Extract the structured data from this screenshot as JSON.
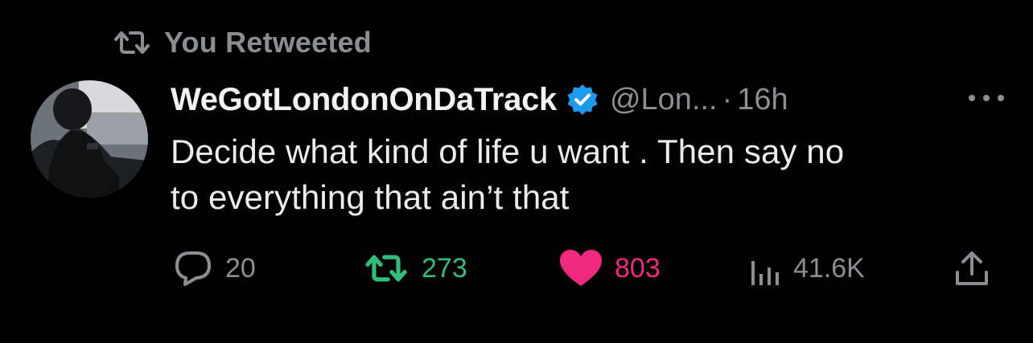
{
  "retweet_header": {
    "label": "You Retweeted",
    "icon": "retweet-icon"
  },
  "tweet": {
    "avatar_icon": "avatar",
    "display_name": "WeGotLondonOnDaTrack",
    "verified": true,
    "handle": "@Lon...",
    "separator": "·",
    "timestamp": "16h",
    "text_line1": "Decide what kind of life u want . Then say no",
    "text_line2": "to everything that ain’t that"
  },
  "actions": {
    "reply": {
      "count": "20",
      "icon": "reply-icon"
    },
    "retweet": {
      "count": "273",
      "icon": "retweet-icon",
      "active": true
    },
    "like": {
      "count": "803",
      "icon": "heart-icon",
      "active": true
    },
    "views": {
      "count": "41.6K",
      "icon": "views-icon"
    },
    "share": {
      "icon": "share-icon"
    }
  },
  "colors": {
    "background": "#000000",
    "text": "#ececec",
    "muted": "#8b8f94",
    "retweet_green": "#2fbf7a",
    "like_pink": "#f0287f",
    "verified_blue": "#1d9bf0"
  }
}
